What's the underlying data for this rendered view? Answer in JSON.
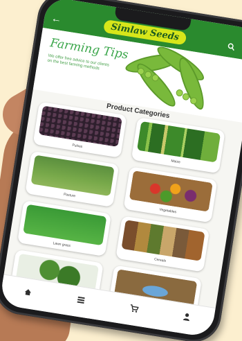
{
  "app": {
    "brand_name": "Simlaw Seeds"
  },
  "icons": {
    "back": "arrow-left-icon",
    "search": "search-icon",
    "menu": "more-vertical-icon",
    "home": "home-icon",
    "catalog": "list-icon",
    "cart": "cart-icon",
    "profile": "person-icon"
  },
  "banner": {
    "title": "Farming Tips",
    "text": "We offer free advice to our clients on the best farming methods"
  },
  "categories_title": "Product Categories",
  "categories": [
    {
      "label": "Pulses"
    },
    {
      "label": "Maize"
    },
    {
      "label": "Pasture"
    },
    {
      "label": "Vegetables"
    },
    {
      "label": "Lawn grass"
    },
    {
      "label": "Cereals"
    },
    {
      "label": ""
    },
    {
      "label": ""
    }
  ],
  "colors": {
    "appbar": "#2a8a2e",
    "brand_pill": "#d7e61a"
  }
}
